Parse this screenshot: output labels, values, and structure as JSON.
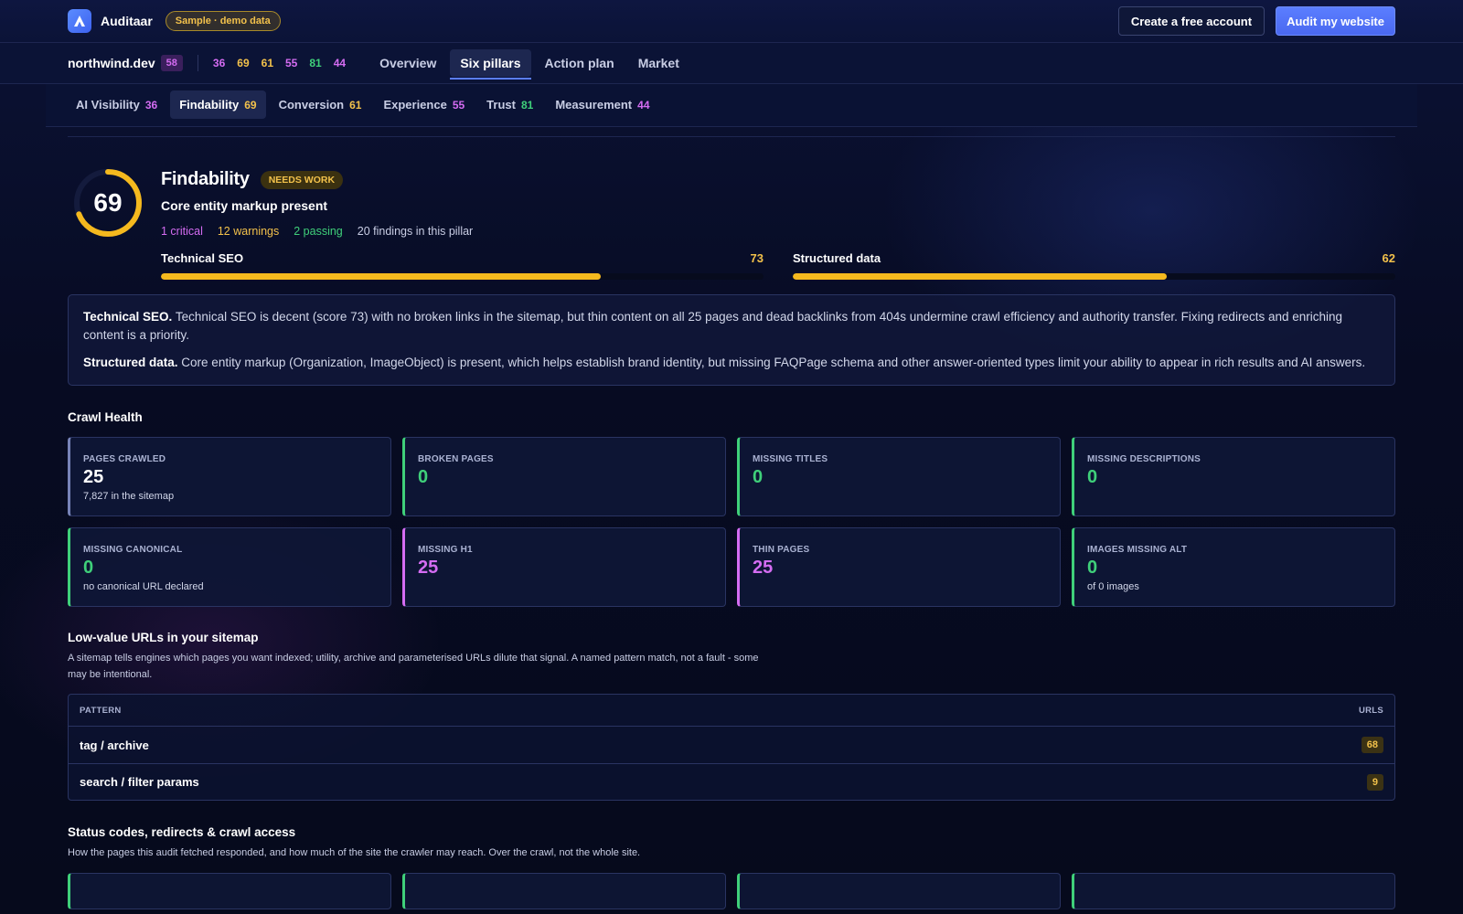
{
  "topbar": {
    "brand": "Auditaar",
    "sample_badge": "Sample · demo data",
    "create_account": "Create a free account",
    "audit_website": "Audit my website"
  },
  "domainbar": {
    "domain": "northwind.dev",
    "overall_score": "58",
    "mini_scores": [
      {
        "value": "36",
        "color": "#d46cf2"
      },
      {
        "value": "69",
        "color": "#f2c14b"
      },
      {
        "value": "61",
        "color": "#f2c14b"
      },
      {
        "value": "55",
        "color": "#d46cf2"
      },
      {
        "value": "81",
        "color": "#3fd07a"
      },
      {
        "value": "44",
        "color": "#d46cf2"
      }
    ],
    "nav": [
      "Overview",
      "Six pillars",
      "Action plan",
      "Market"
    ],
    "active_nav": "Six pillars"
  },
  "pillars": [
    {
      "label": "AI Visibility",
      "score": "36",
      "color": "#d46cf2"
    },
    {
      "label": "Findability",
      "score": "69",
      "color": "#f2c14b"
    },
    {
      "label": "Conversion",
      "score": "61",
      "color": "#f2c14b"
    },
    {
      "label": "Experience",
      "score": "55",
      "color": "#d46cf2"
    },
    {
      "label": "Trust",
      "score": "81",
      "color": "#3fd07a"
    },
    {
      "label": "Measurement",
      "score": "44",
      "color": "#d46cf2"
    }
  ],
  "pillar": {
    "score": "69",
    "score_fraction": 0.69,
    "title": "Findability",
    "status": "NEEDS WORK",
    "subtitle": "Core entity markup present",
    "critical": "1 critical",
    "warnings": "12 warnings",
    "passing": "2 passing",
    "total": "20 findings in this pillar",
    "bars": [
      {
        "label": "Technical SEO",
        "value": "73",
        "fraction": 0.73
      },
      {
        "label": "Structured data",
        "value": "62",
        "fraction": 0.62
      }
    ]
  },
  "summary": {
    "p1_title": "Technical SEO.",
    "p1_text": "Technical SEO is decent (score 73) with no broken links in the sitemap, but thin content on all 25 pages and dead backlinks from 404s undermine crawl efficiency and authority transfer. Fixing redirects and enriching content is a priority.",
    "p2_title": "Structured data.",
    "p2_text": "Core entity markup (Organization, ImageObject) is present, which helps establish brand identity, but missing FAQPage schema and other answer-oriented types limit your ability to appear in rich results and AI answers."
  },
  "crawl_health": {
    "title": "Crawl Health",
    "cards": [
      {
        "label": "PAGES CRAWLED",
        "value": "25",
        "sub": "7,827 in the sitemap",
        "tone": "neutral"
      },
      {
        "label": "BROKEN PAGES",
        "value": "0",
        "sub": "",
        "tone": "good"
      },
      {
        "label": "MISSING TITLES",
        "value": "0",
        "sub": "",
        "tone": "good"
      },
      {
        "label": "MISSING DESCRIPTIONS",
        "value": "0",
        "sub": "",
        "tone": "good"
      },
      {
        "label": "MISSING CANONICAL",
        "value": "0",
        "sub": "no canonical URL declared",
        "tone": "good"
      },
      {
        "label": "MISSING H1",
        "value": "25",
        "sub": "",
        "tone": "bad"
      },
      {
        "label": "THIN PAGES",
        "value": "25",
        "sub": "",
        "tone": "bad"
      },
      {
        "label": "IMAGES MISSING ALT",
        "value": "0",
        "sub": "of 0 images",
        "tone": "good"
      }
    ]
  },
  "low_value": {
    "title": "Low-value URLs in your sitemap",
    "desc": "A sitemap tells engines which pages you want indexed; utility, archive and parameterised URLs dilute that signal. A named pattern match, not a fault - some may be intentional.",
    "col_pattern": "PATTERN",
    "col_urls": "URLS",
    "rows": [
      {
        "pattern": "tag / archive",
        "urls": "68"
      },
      {
        "pattern": "search / filter params",
        "urls": "9"
      }
    ]
  },
  "status_codes": {
    "title": "Status codes, redirects & crawl access",
    "desc": "How the pages this audit fetched responded, and how much of the site the crawler may reach. Over the crawl, not the whole site."
  }
}
